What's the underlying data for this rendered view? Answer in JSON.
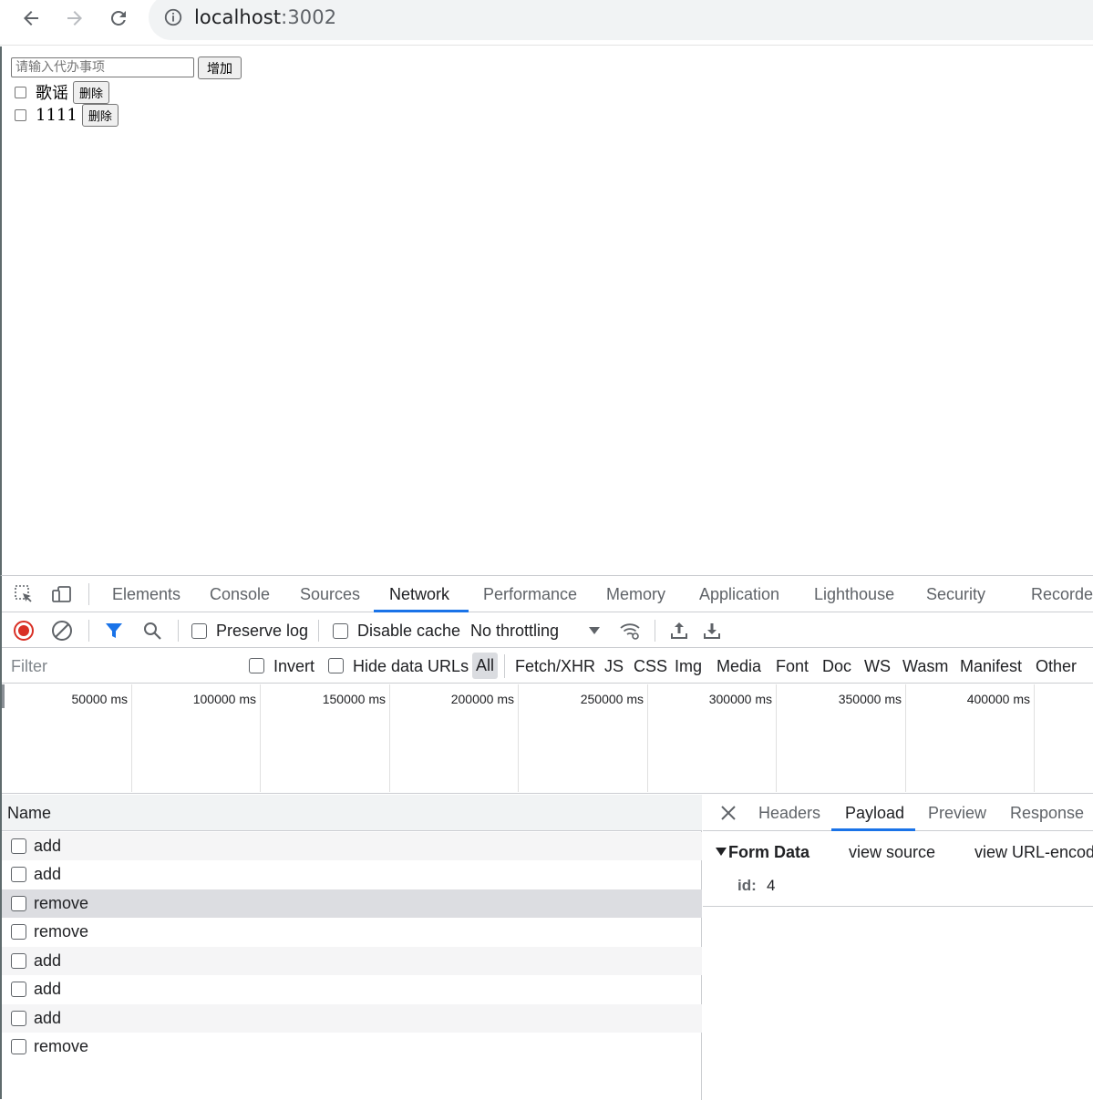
{
  "browser": {
    "url_host": "localhost",
    "url_port": ":3002"
  },
  "page": {
    "input_placeholder": "请输入代办事项",
    "add_button_label": "增加",
    "todos": [
      {
        "text": "歌谣",
        "delete_label": "删除"
      },
      {
        "text": "1111",
        "delete_label": "删除"
      }
    ]
  },
  "devtools": {
    "tabs": [
      "Elements",
      "Console",
      "Sources",
      "Network",
      "Performance",
      "Memory",
      "Application",
      "Lighthouse",
      "Security",
      "Recorder"
    ],
    "active_tab": "Network",
    "toolbar": {
      "preserve_log": "Preserve log",
      "disable_cache": "Disable cache",
      "throttling": "No throttling"
    },
    "filterbar": {
      "filter_placeholder": "Filter",
      "invert": "Invert",
      "hide_data_urls": "Hide data URLs",
      "types": [
        "All",
        "Fetch/XHR",
        "JS",
        "CSS",
        "Img",
        "Media",
        "Font",
        "Doc",
        "WS",
        "Wasm",
        "Manifest",
        "Other"
      ],
      "active_type": "All"
    },
    "timeline_labels": [
      "50000 ms",
      "100000 ms",
      "150000 ms",
      "200000 ms",
      "250000 ms",
      "300000 ms",
      "350000 ms",
      "400000 ms"
    ],
    "requests": {
      "header_name": "Name",
      "rows": [
        "add",
        "add",
        "remove",
        "remove",
        "add",
        "add",
        "add",
        "remove"
      ],
      "selected_index": 2
    },
    "detail": {
      "tabs": [
        "Headers",
        "Payload",
        "Preview",
        "Response"
      ],
      "active_tab": "Payload",
      "form_title": "Form Data",
      "view_source": "view source",
      "view_url_encoded": "view URL-encoded",
      "form_key": "id:",
      "form_value": "4"
    },
    "colors": {
      "accent": "#1a73e8",
      "record_red": "#d93025"
    }
  }
}
